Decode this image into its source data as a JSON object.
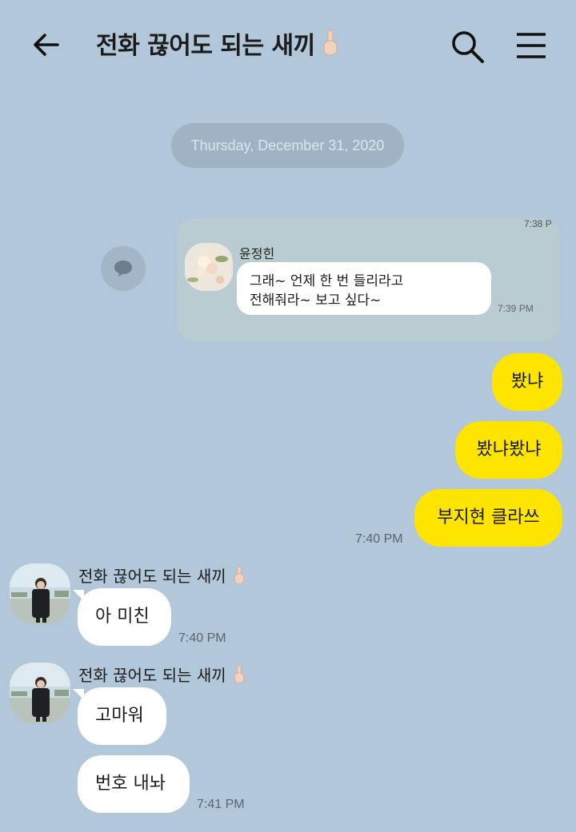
{
  "header": {
    "title": "전화 끊어도 되는 새끼",
    "title_emoji": "middle-finger-emoji"
  },
  "date_divider": "Thursday, December 31, 2020",
  "forwarded": {
    "top_time": "7:38 P",
    "sender": "윤정힌",
    "line1": "그래~ 언제 한 번 들리라고",
    "line2": "전해줘라~ 보고 싶다~",
    "time": "7:39 PM"
  },
  "outgoing": [
    {
      "text": "봤냐"
    },
    {
      "text": "봤냐봤냐"
    },
    {
      "text": "부지현 클라쓰"
    }
  ],
  "outgoing_time": "7:40 PM",
  "incoming_groups": [
    {
      "sender": "전화 끊어도 되는 새끼",
      "messages": [
        {
          "text": "아 미친",
          "time": "7:40 PM"
        }
      ]
    },
    {
      "sender": "전화 끊어도 되는 새끼",
      "messages": [
        {
          "text": "고마워"
        },
        {
          "text": "번호 내놔",
          "time": "7:41 PM"
        }
      ]
    }
  ],
  "colors": {
    "background": "#b2c7d9",
    "outgoing_bubble": "#fee500",
    "incoming_bubble": "#ffffff"
  }
}
